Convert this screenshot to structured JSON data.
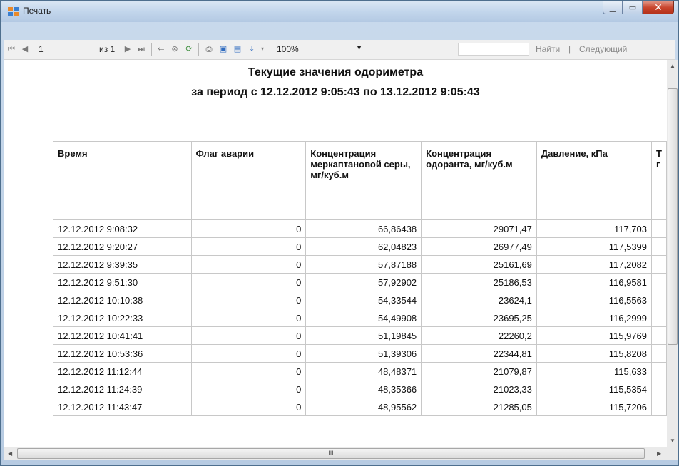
{
  "window": {
    "title": "Печать"
  },
  "toolbar": {
    "page_current": "1",
    "page_total": "из 1",
    "zoom": "100%",
    "find_label": "Найти",
    "next_label": "Следующий",
    "sep": "|"
  },
  "report": {
    "title": "Текущие значения одориметра",
    "subtitle": "за период с 12.12.2012 9:05:43 по 13.12.2012 9:05:43",
    "columns": [
      "Время",
      "Флаг аварии",
      "Концентрация меркаптановой серы, мг/куб.м",
      "Концентрация одоранта, мг/куб.м",
      "Давление, кПа",
      "Т г"
    ],
    "rows": [
      [
        "12.12.2012 9:08:32",
        "0",
        "66,86438",
        "29071,47",
        "117,703"
      ],
      [
        "12.12.2012 9:20:27",
        "0",
        "62,04823",
        "26977,49",
        "117,5399"
      ],
      [
        "12.12.2012 9:39:35",
        "0",
        "57,87188",
        "25161,69",
        "117,2082"
      ],
      [
        "12.12.2012 9:51:30",
        "0",
        "57,92902",
        "25186,53",
        "116,9581"
      ],
      [
        "12.12.2012 10:10:38",
        "0",
        "54,33544",
        "23624,1",
        "116,5563"
      ],
      [
        "12.12.2012 10:22:33",
        "0",
        "54,49908",
        "23695,25",
        "116,2999"
      ],
      [
        "12.12.2012 10:41:41",
        "0",
        "51,19845",
        "22260,2",
        "115,9769"
      ],
      [
        "12.12.2012 10:53:36",
        "0",
        "51,39306",
        "22344,81",
        "115,8208"
      ],
      [
        "12.12.2012 11:12:44",
        "0",
        "48,48371",
        "21079,87",
        "115,633"
      ],
      [
        "12.12.2012 11:24:39",
        "0",
        "48,35366",
        "21023,33",
        "115,5354"
      ],
      [
        "12.12.2012 11:43:47",
        "0",
        "48,95562",
        "21285,05",
        "115,7206"
      ]
    ]
  },
  "scroll": {
    "grip": "III"
  }
}
